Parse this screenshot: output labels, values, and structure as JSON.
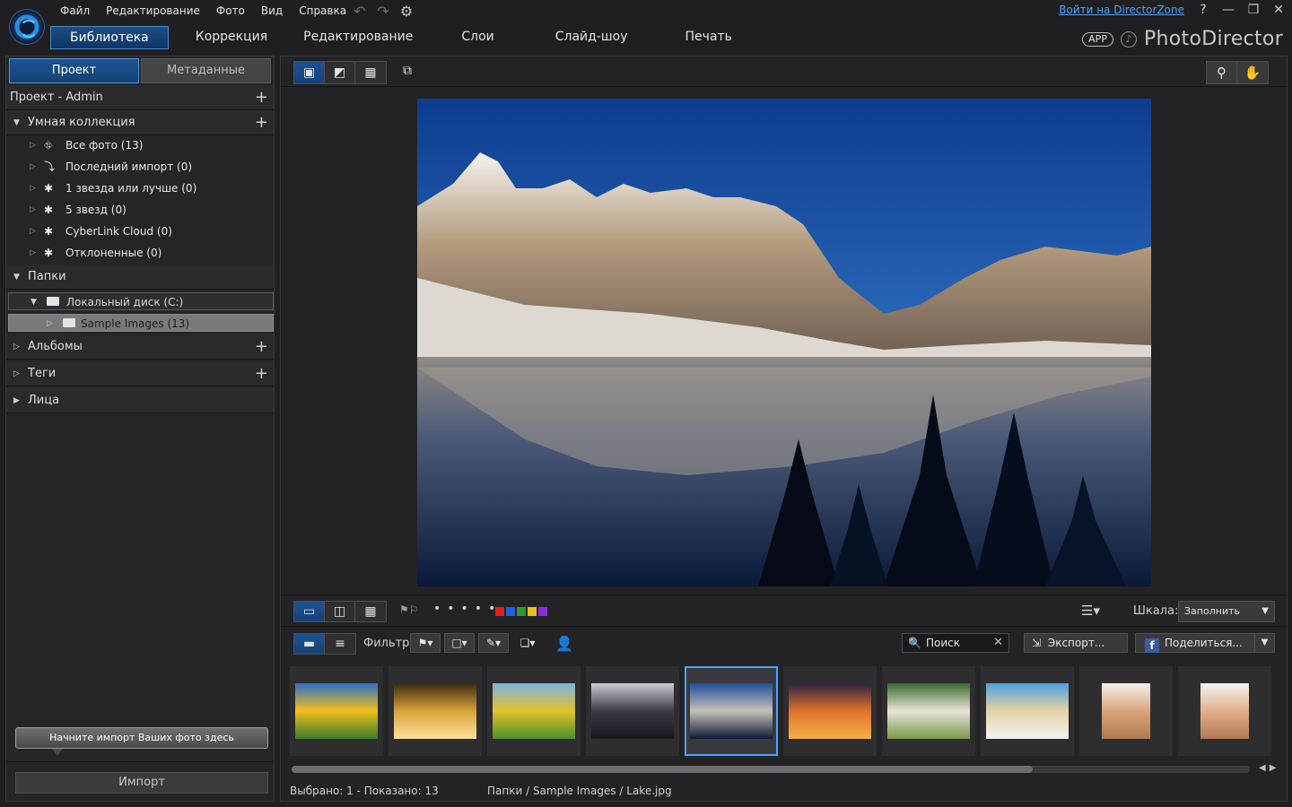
{
  "menu": [
    "Файл",
    "Редактирование",
    "Фото",
    "Вид",
    "Справка"
  ],
  "top_right": {
    "login_link": "Войти на DirectorZone",
    "help": "?",
    "minimize": "—",
    "restore": "❐",
    "close": "✕"
  },
  "tabs": [
    "Библиотека",
    "Коррекция",
    "Редактирование",
    "Слои",
    "Слайд-шоу",
    "Печать"
  ],
  "brand": {
    "app_badge": "APP",
    "name": "PhotoDirector"
  },
  "left_panel": {
    "tabs": [
      "Проект",
      "Метаданные"
    ],
    "project_label": "Проект - Admin",
    "smart_collection": {
      "label": "Умная коллекция",
      "items": [
        "Все фото (13)",
        "Последний импорт (0)",
        "1 звезда или лучше (0)",
        "5 звезд (0)",
        "CyberLink Cloud (0)",
        "Отклоненные (0)"
      ]
    },
    "folders": {
      "label": "Папки",
      "disk": "Локальный диск (C:)",
      "sample": "Sample Images (13)"
    },
    "albums": "Альбомы",
    "tags": "Теги",
    "faces": "Лица",
    "import_tip": "Начните импорт Ваших фото здесь",
    "import_button": "Импорт"
  },
  "toolbar": {
    "scale_label": "Шкала:",
    "scale_value": "Заполнить",
    "filter_label": "Фильтр:",
    "search_placeholder": "Поиск",
    "export_label": "Экспорт...",
    "share_label": "Поделиться...",
    "color_labels": [
      "#e0201b",
      "#1f5fe0",
      "#2e9a2e",
      "#e8c21a",
      "#8a2be2"
    ]
  },
  "thumbnails": [
    {
      "name": "sunflower",
      "colors": [
        "#2d6ec9",
        "#f2c01a",
        "#3b7a2a"
      ]
    },
    {
      "name": "spiral",
      "colors": [
        "#3a2a10",
        "#d9a23a",
        "#fbe39c"
      ]
    },
    {
      "name": "bicycle",
      "colors": [
        "#7fb3e0",
        "#e2c22a",
        "#4f8f2a"
      ]
    },
    {
      "name": "boat",
      "colors": [
        "#c9ccd1",
        "#3a3d44",
        "#15171b"
      ]
    },
    {
      "name": "lake",
      "colors": [
        "#1f4f9a",
        "#c8c1b8",
        "#0d1b35"
      ]
    },
    {
      "name": "sunset",
      "colors": [
        "#2b2243",
        "#e0722b",
        "#f3b046"
      ]
    },
    {
      "name": "cat",
      "colors": [
        "#3b6a2d",
        "#e9e4da",
        "#7a9a4a"
      ]
    },
    {
      "name": "beach",
      "colors": [
        "#4da0e0",
        "#e7d3a6",
        "#f2f2f2"
      ]
    },
    {
      "name": "woman",
      "colors": [
        "#f3f0eb",
        "#d9a57a",
        "#b07a52"
      ]
    },
    {
      "name": "girl",
      "colors": [
        "#f4f4f4",
        "#e0b08a",
        "#b07a52"
      ]
    }
  ],
  "status": {
    "selection": "Выбрано: 1 - Показано: 13",
    "path": "Папки / Sample Images / Lake.jpg"
  }
}
